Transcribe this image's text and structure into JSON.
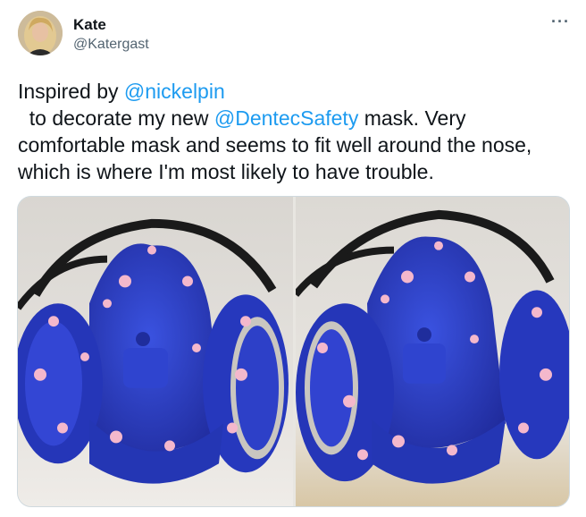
{
  "user": {
    "name": "Kate",
    "handle": "@Katergast",
    "avatar_icon": "profile-photo"
  },
  "menu_icon": "more-icon",
  "tweet": {
    "text_parts": [
      "Inspired by ",
      "@nickelpin",
      "  to decorate my new ",
      "@DentecSafety",
      " mask. Very comfortable mask and seems to fit well around the nose, which is where I'm most likely to have trouble."
    ]
  },
  "media": {
    "photos": [
      {
        "subject": "painted-respirator-mask-front"
      },
      {
        "subject": "painted-respirator-mask-angle"
      }
    ]
  },
  "colors": {
    "mention": "#1d9bf0",
    "mask_blue": "#2c3fc4",
    "blossom_pink": "#f4b8cc"
  }
}
